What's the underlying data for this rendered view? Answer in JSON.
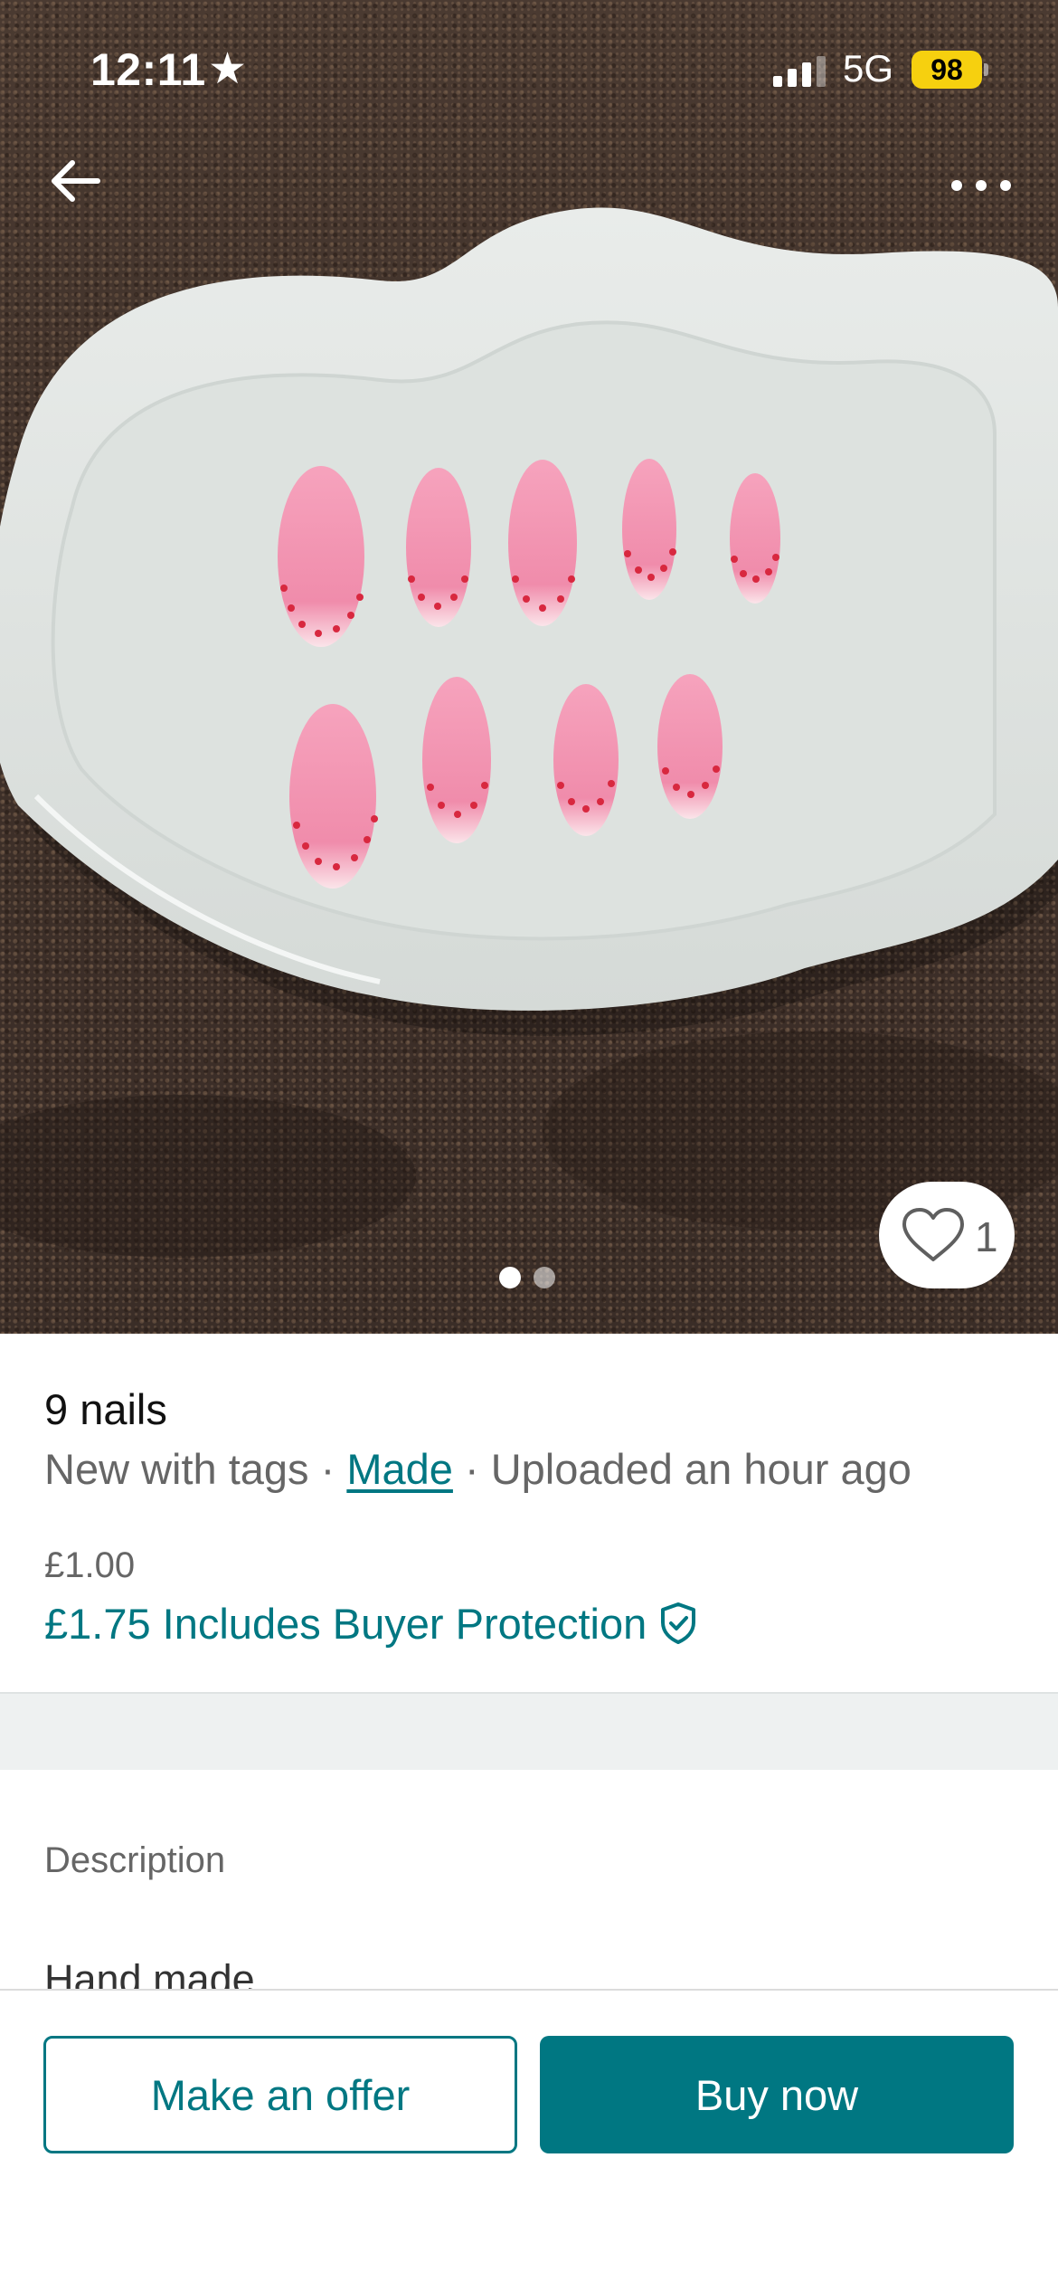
{
  "status_bar": {
    "time": "12:11",
    "network": "5G",
    "battery": "98"
  },
  "photo": {
    "page_indicator": {
      "current": 1,
      "total": 2
    }
  },
  "favorite": {
    "count": "1"
  },
  "item": {
    "title": "9 nails",
    "condition": "New with tags",
    "separator": " · ",
    "brand": "Made",
    "uploaded": "Uploaded an hour ago",
    "price": "£1.00",
    "total_price": "£1.75 Includes Buyer Protection"
  },
  "description": {
    "label": "Description",
    "text": "Hand made"
  },
  "actions": {
    "offer_label": "Make an offer",
    "buy_label": "Buy now"
  },
  "colors": {
    "accent": "#007782",
    "battery": "#f6d00f"
  }
}
